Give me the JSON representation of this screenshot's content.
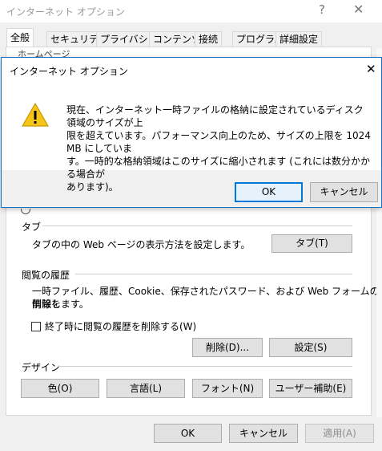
{
  "background_window": {
    "title": "インターネット オプション",
    "help_glyph": "?",
    "close_glyph": "✕",
    "tabs": [
      "全般",
      "セキュリティ",
      "プライバシー",
      "コンテンツ",
      "接続",
      "プログラム",
      "詳細設定"
    ],
    "homepage_partial": "ホームページ",
    "tabs_section": {
      "label": "タブ",
      "description": "タブの中の Web ページの表示方法を設定します。",
      "button": "タブ(T)"
    },
    "history_section": {
      "label": "閲覧の履歴",
      "description_line1": "一時ファイル、履歴、Cookie、保存されたパスワード、および Web フォームの情報を",
      "description_line2": "削除します。",
      "checkbox_label": "終了時に閲覧の履歴を削除する(W)",
      "delete_button": "削除(D)...",
      "settings_button": "設定(S)"
    },
    "design_section": {
      "label": "デザイン",
      "buttons": [
        "色(O)",
        "言語(L)",
        "フォント(N)",
        "ユーザー補助(E)"
      ]
    },
    "footer": {
      "ok": "OK",
      "cancel": "キャンセル",
      "apply": "適用(A)"
    }
  },
  "message_dialog": {
    "title": "インターネット オプション",
    "close_glyph": "✕",
    "icon": "warning-icon",
    "message_lines": [
      "現在、インターネット一時ファイルの格納に設定されているディスク領域のサイズが上",
      "限を超えています。パフォーマンス向上のため、サイズの上限を 1024 MB にしていま",
      "す。一時的な格納領域はこのサイズに縮小されます (これには数分かかる場合が",
      "あります)。"
    ],
    "ok": "OK",
    "cancel": "キャンセル"
  },
  "colors": {
    "accent": "#0078d7",
    "warning_fill": "#f5c518",
    "window_bg": "#f0f0f0",
    "button_bg": "#e1e1e1"
  }
}
